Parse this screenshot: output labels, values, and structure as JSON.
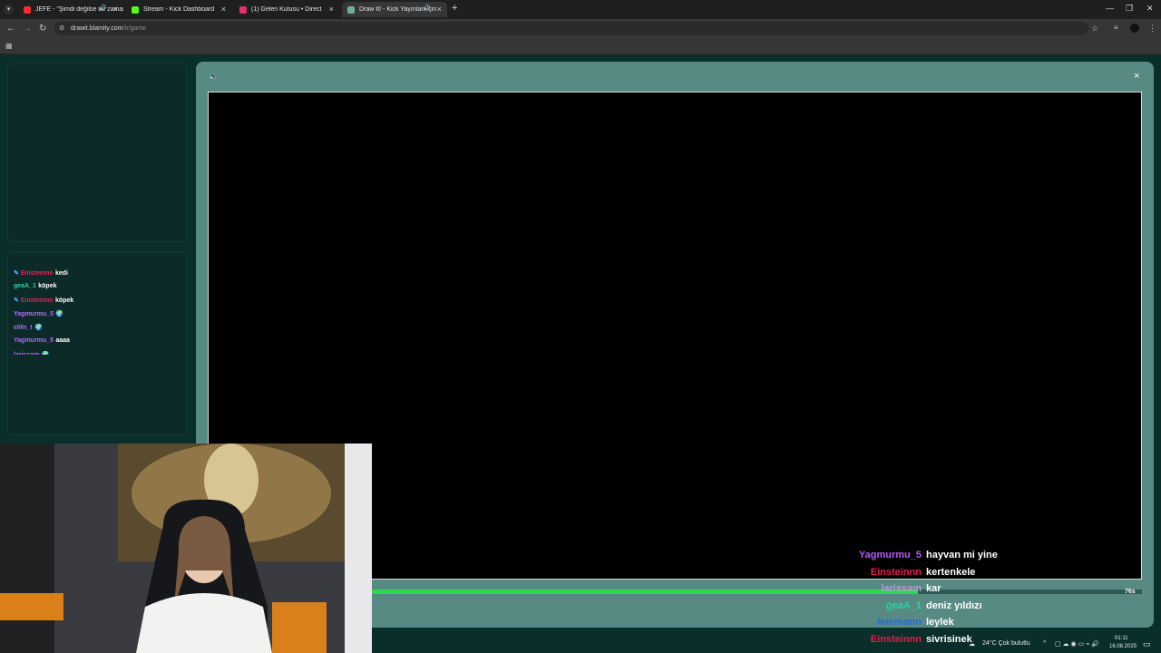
{
  "browser": {
    "tabs": [
      {
        "title": "JEFE - \"Şimdi değilse ne zaman",
        "favicon_color": "#ff2a2a",
        "audio": true
      },
      {
        "title": "Stream - Kick Dashboard",
        "favicon_color": "#53fc18",
        "audio": false
      },
      {
        "title": "(1) Gelen Kutusu • Direct",
        "favicon_color": "#e1306c",
        "audio": false
      },
      {
        "title": "Draw It! - Kick Yayınları İçin",
        "favicon_color": "#6fae9c",
        "audio": true,
        "active": true
      }
    ],
    "new_tab_label": "+",
    "url_host": "drawit.blamity.com",
    "url_path": "/tr/game"
  },
  "chat_panel": {
    "messages": [
      {
        "user": "Einsteinnn",
        "text": "kedi",
        "color": "#e0245e",
        "badge": true
      },
      {
        "user": "geaA_1",
        "text": "köpek",
        "color": "#2ad1a3",
        "badge": false
      },
      {
        "user": "Einsteinnn",
        "text": "köpek",
        "color": "#e0245e",
        "badge": true
      },
      {
        "user": "Yagmurmu_5",
        "text": "🌍",
        "color": "#b06bff",
        "badge": false
      },
      {
        "user": "elifn_t",
        "text": "🌍",
        "color": "#b06bff",
        "badge": false
      },
      {
        "user": "Yagmurmu_5",
        "text": "aaaa",
        "color": "#b06bff",
        "badge": false
      },
      {
        "user": "larissam",
        "text": "🌍",
        "color": "#b06bff",
        "badge": false
      }
    ]
  },
  "game": {
    "sound_icon": "speaker-icon",
    "close_label": "×",
    "timer": "76s",
    "progress_fraction": 0.76
  },
  "overlay_chat": [
    {
      "user": "Yagmurmu_5",
      "text": "hayvan mi yine",
      "color": "#b55cf0"
    },
    {
      "user": "Einsteinnn",
      "text": "kertenkele",
      "color": "#e01e4b"
    },
    {
      "user": "larissam",
      "text": "kar",
      "color": "#b39ddb"
    },
    {
      "user": "geaA_1",
      "text": "deniz yıldızı",
      "color": "#2ad1a3"
    },
    {
      "user": "lemmonn",
      "text": "leylek",
      "color": "#2a6bd1"
    },
    {
      "user": "Einsteinnn",
      "text": "sivrisinek",
      "color": "#e01e4b"
    }
  ],
  "taskbar": {
    "weather": "24°C  Çok bulutlu",
    "time": "01:11",
    "date": "16.08.2025"
  }
}
